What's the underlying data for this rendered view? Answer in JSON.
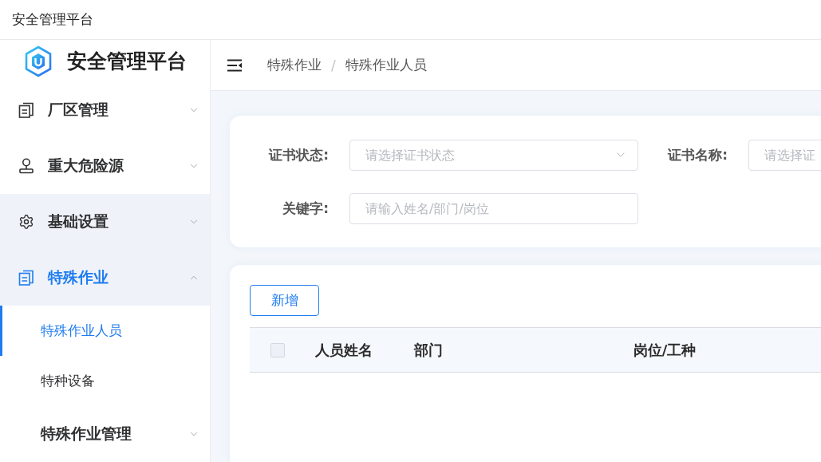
{
  "window": {
    "title": "安全管理平台"
  },
  "sidebar": {
    "brand": "安全管理平台",
    "menu": [
      {
        "label": "厂区管理",
        "expanded": false,
        "highlighted": false,
        "active": false
      },
      {
        "label": "重大危险源",
        "expanded": false,
        "highlighted": false,
        "active": false
      },
      {
        "label": "基础设置",
        "expanded": false,
        "highlighted": true,
        "active": false
      },
      {
        "label": "特殊作业",
        "expanded": true,
        "highlighted": true,
        "active": true,
        "children": [
          {
            "kind": "item",
            "label": "特殊作业人员",
            "selected": true
          },
          {
            "kind": "item",
            "label": "特种设备",
            "selected": false
          },
          {
            "kind": "group",
            "label": "特殊作业管理",
            "selected": false,
            "expanded": false
          }
        ]
      }
    ]
  },
  "header": {
    "breadcrumb": {
      "items": [
        "特殊作业",
        "特殊作业人员"
      ],
      "separator": "/"
    }
  },
  "filters": [
    {
      "kind": "select",
      "label": "证书状态:",
      "placeholder": "请选择证书状态"
    },
    {
      "kind": "select",
      "label": "证书名称:",
      "placeholder": "请选择证"
    },
    {
      "kind": "input",
      "label": "关键字:",
      "placeholder": "请输入姓名/部门/岗位"
    }
  ],
  "toolbar": {
    "buttons": [
      "新增"
    ]
  },
  "table": {
    "select_all": {
      "checked": false
    },
    "columns": [
      "人员姓名",
      "部门",
      "岗位/工种"
    ]
  }
}
